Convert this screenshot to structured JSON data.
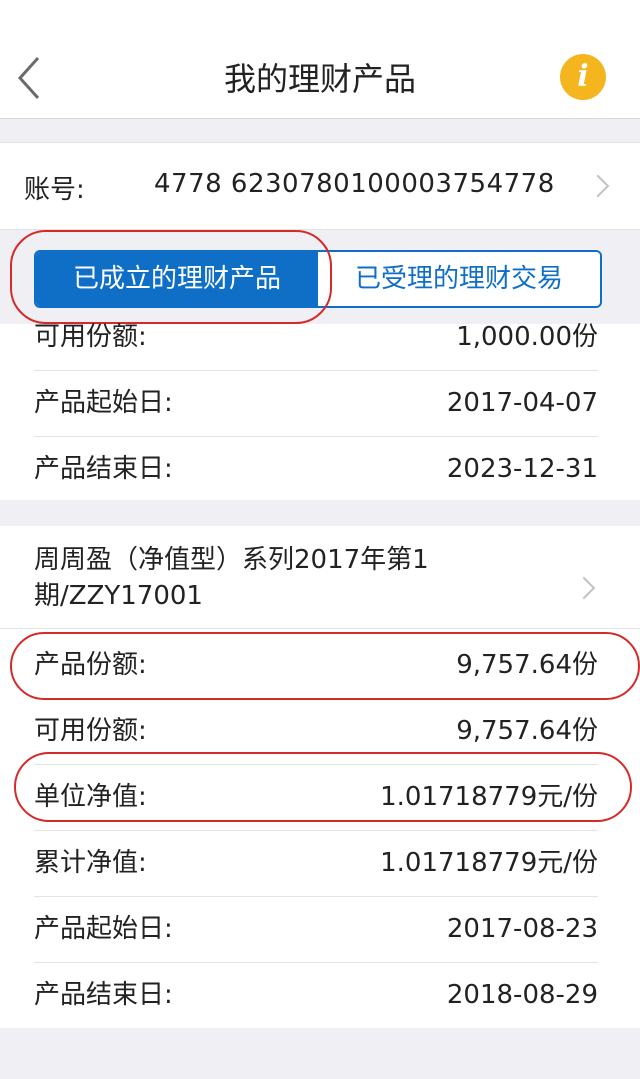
{
  "header": {
    "title": "我的理财产品",
    "info_icon": "info-icon"
  },
  "account": {
    "label": "账号:",
    "number": "4778  6230780100003754778"
  },
  "tabs": [
    {
      "label": "已成立的理财产品",
      "active": true
    },
    {
      "label": "已受理的理财交易",
      "active": false
    }
  ],
  "product1": {
    "rows": [
      {
        "label": "可用份额:",
        "value": "1,000.00份"
      },
      {
        "label": "产品起始日:",
        "value": "2017-04-07"
      },
      {
        "label": "产品结束日:",
        "value": "2023-12-31"
      }
    ]
  },
  "product2": {
    "title": "周周盈（净值型）系列2017年第1期/ZZY17001",
    "rows": [
      {
        "label": "产品份额:",
        "value": "9,757.64份"
      },
      {
        "label": "可用份额:",
        "value": "9,757.64份"
      },
      {
        "label": "单位净值:",
        "value": "1.01718779元/份"
      },
      {
        "label": "累计净值:",
        "value": "1.01718779元/份"
      },
      {
        "label": "产品起始日:",
        "value": "2017-08-23"
      },
      {
        "label": "产品结束日:",
        "value": "2018-08-29"
      }
    ]
  },
  "colors": {
    "accent": "#0f6fc6",
    "annotation": "#d42a2a",
    "info": "#f5b51f"
  }
}
